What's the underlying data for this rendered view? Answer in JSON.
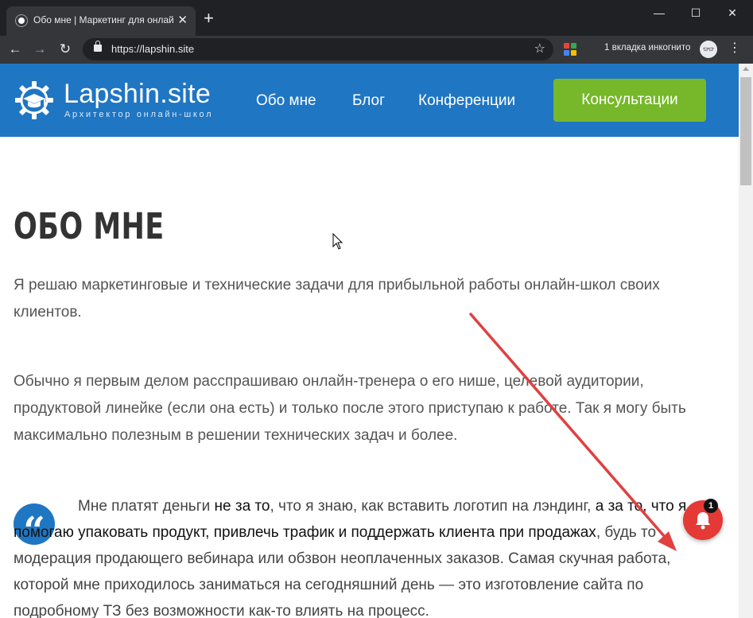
{
  "browser": {
    "tab_title": "Обо мне | Маркетинг для онлай",
    "tab_close": "✕",
    "new_tab": "+",
    "window_controls": {
      "minimize": "—",
      "maximize": "☐",
      "close": "✕"
    },
    "nav": {
      "back": "←",
      "forward": "→",
      "reload": "↻"
    },
    "url": "https://lapshin.site",
    "bookmark_icon": "☆",
    "incognito_label": "1 вкладка инкогнито",
    "incognito_icon": "👓",
    "menu_icon": "⋮",
    "extension_colors": [
      "#ea4335",
      "#34a853",
      "#4285f4",
      "#fbbc05"
    ]
  },
  "site": {
    "logo_text": "Lapshin.site",
    "logo_subtitle": "Архитектор онлайн-школ",
    "nav": [
      "Обо мне",
      "Блог",
      "Конференции"
    ],
    "cta_label": "Консультации",
    "brand_color": "#1f76c3",
    "cta_color": "#76b82a"
  },
  "content": {
    "heading": "ОБО МНЕ",
    "para1": "Я решаю маркетинговые и технические задачи для прибыльной работы онлайн-школ своих клиентов.",
    "para2": "Обычно я первым делом расспрашиваю онлайн-тренера о его нише, целевой аудитории, продуктовой линейке (если она есть) и только после этого приступаю к работе. Так я могу быть максимально полезным в решении технических задач и более.",
    "quote_icon": "“",
    "quote": {
      "t1": "Мне платят деньги ",
      "b1": "не за то",
      "t2": ", что я знаю, как вставить логотип на лэндинг, ",
      "b2": "а за то, что я помогаю упаковать продукт, привлечь трафик и поддержать клиента при продажах",
      "t3": ", будь то модерация продающего вебинара или обзвон неоплаченных заказов. Самая скучная работа, которой мне приходилось заниматься на сегодняшний день — это изготовление сайта по подробному ТЗ без возможности как-то влиять на процесс."
    }
  },
  "notification": {
    "count": "1",
    "color": "#e53935"
  }
}
